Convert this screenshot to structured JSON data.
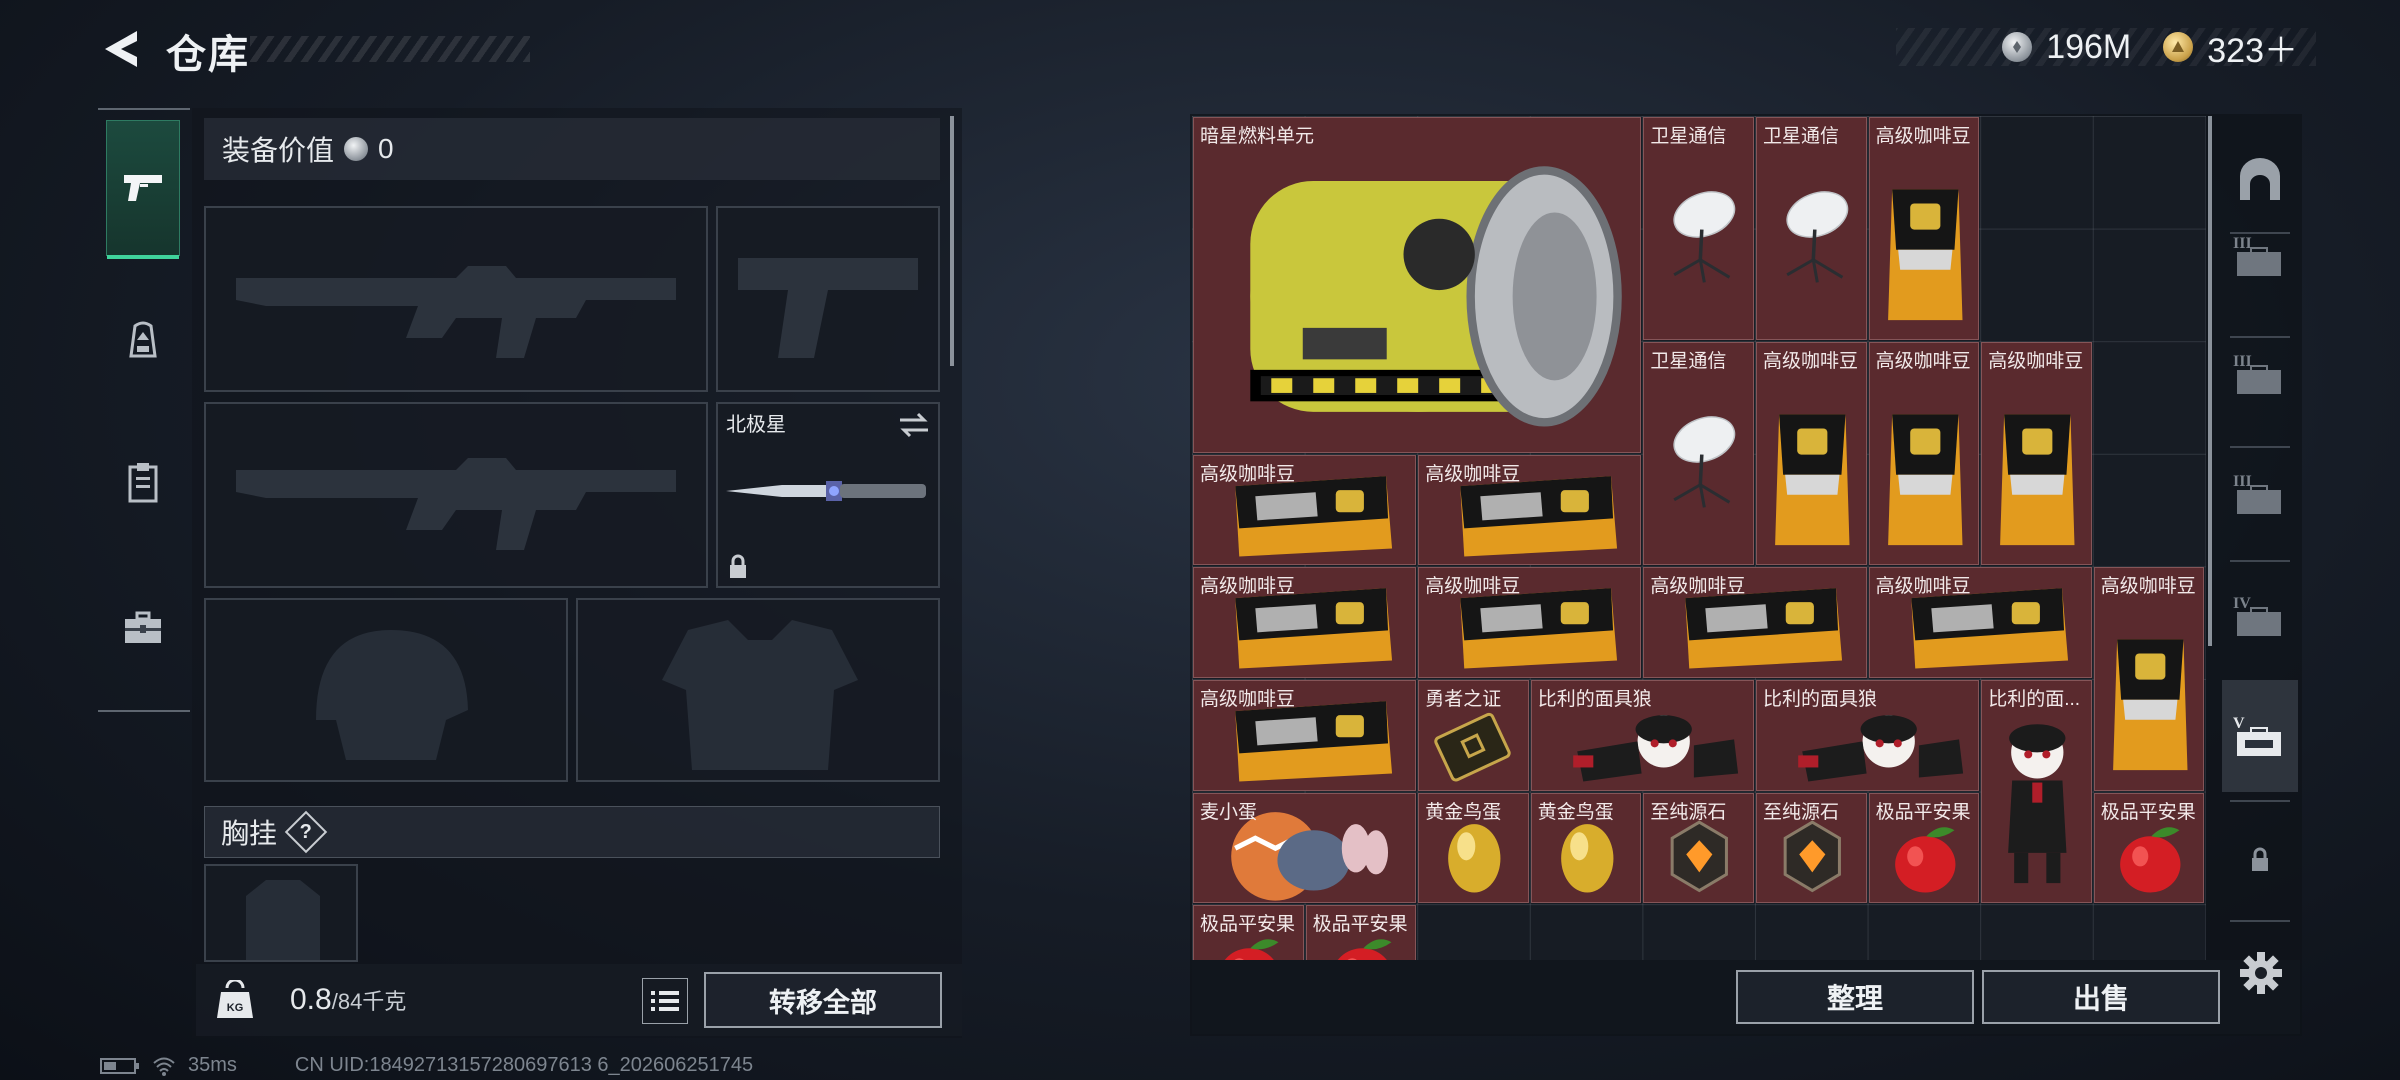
{
  "header": {
    "title": "仓库",
    "currency_silver": "196M",
    "currency_gold": "323＋"
  },
  "left_nav": {
    "items": [
      {
        "name": "weapons",
        "icon": "pistol-icon",
        "active": true
      },
      {
        "name": "gear",
        "icon": "backpack-icon",
        "active": false
      },
      {
        "name": "supplies",
        "icon": "clipboard-icon",
        "active": false
      },
      {
        "name": "cases",
        "icon": "toolbox-icon",
        "active": false
      }
    ]
  },
  "equipment": {
    "value_label": "装备价值",
    "value": "0",
    "melee_name": "北极星",
    "chest_label": "胸挂",
    "help": "?"
  },
  "weight": {
    "current": "0.8",
    "max": "/84千克",
    "icon_text": "KG"
  },
  "buttons": {
    "transfer_all": "转移全部",
    "sort": "整理",
    "sell": "出售"
  },
  "status": {
    "ping": "35ms",
    "uid": "CN UID:18492713157280697613 6_202606251745"
  },
  "stash": {
    "items": [
      {
        "name": "暗星燃料单元",
        "kind": "fuel"
      },
      {
        "name": "卫星通信",
        "kind": "dish"
      },
      {
        "name": "卫星通信",
        "kind": "dish"
      },
      {
        "name": "高级咖啡豆",
        "kind": "coffee-v"
      },
      {
        "name": "卫星通信",
        "kind": "dish"
      },
      {
        "name": "高级咖啡豆",
        "kind": "coffee-v"
      },
      {
        "name": "高级咖啡豆",
        "kind": "coffee-v"
      },
      {
        "name": "高级咖啡豆",
        "kind": "coffee-v"
      },
      {
        "name": "高级咖啡豆",
        "kind": "coffee-h"
      },
      {
        "name": "高级咖啡豆",
        "kind": "coffee-h"
      },
      {
        "name": "高级咖啡豆",
        "kind": "coffee-h"
      },
      {
        "name": "高级咖啡豆",
        "kind": "coffee-h"
      },
      {
        "name": "高级咖啡豆",
        "kind": "coffee-h"
      },
      {
        "name": "高级咖啡豆",
        "kind": "coffee-h"
      },
      {
        "name": "高级咖啡豆",
        "kind": "coffee-v"
      },
      {
        "name": "高级咖啡豆",
        "kind": "coffee-h"
      },
      {
        "name": "勇者之证",
        "kind": "badge"
      },
      {
        "name": "比利的面具狼",
        "kind": "puppet"
      },
      {
        "name": "比利的面具狼",
        "kind": "puppet"
      },
      {
        "name": "比利的面...",
        "kind": "puppet-v"
      },
      {
        "name": "麦小蛋",
        "kind": "egg-doll"
      },
      {
        "name": "黄金鸟蛋",
        "kind": "gold-egg"
      },
      {
        "name": "黄金鸟蛋",
        "kind": "gold-egg"
      },
      {
        "name": "至纯源石",
        "kind": "gem"
      },
      {
        "name": "至纯源石",
        "kind": "gem"
      },
      {
        "name": "极品平安果",
        "kind": "apple"
      },
      {
        "name": "极品平安果",
        "kind": "apple"
      },
      {
        "name": "极品平安果",
        "kind": "apple"
      },
      {
        "name": "极品平安果",
        "kind": "apple"
      }
    ]
  },
  "side_tabs": {
    "items": [
      {
        "icon": "arch-icon"
      },
      {
        "icon": "case-tier-3-icon",
        "label": "III"
      },
      {
        "icon": "case-tier-3-icon",
        "label": "III"
      },
      {
        "icon": "case-tier-3-icon",
        "label": "III"
      },
      {
        "icon": "case-tier-4-icon",
        "label": "IV"
      },
      {
        "icon": "case-tier-5-icon",
        "label": "V",
        "active": true
      },
      {
        "icon": "lock-icon"
      }
    ]
  }
}
